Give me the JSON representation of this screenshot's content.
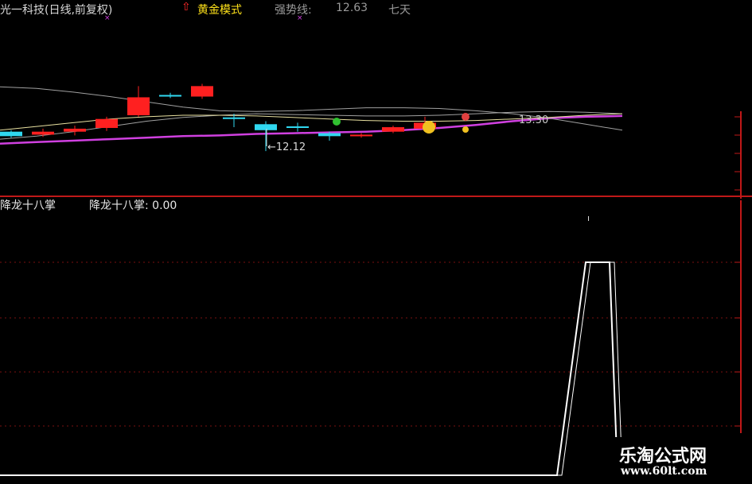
{
  "header": {
    "stock_label": "光一科技(日线,前复权)",
    "mode_arrow": "⇧",
    "mode_label": "黄金模式",
    "strong_line_label": "强势线:",
    "strong_line_value": "12.63",
    "truncated_label": "七天"
  },
  "colors": {
    "background": "#000000",
    "up_candle": "#ff2020",
    "down_candle": "#30d8f0",
    "purple_line": "#d040e0",
    "red_axis": "#c01818",
    "white_line": "#ffffff"
  },
  "annotations": {
    "low_price": "←12.12",
    "high_price": "13.30"
  },
  "indicator": {
    "title": "降龙十八掌",
    "value_label": "降龙十八掌: 0.00"
  },
  "watermark": {
    "name": "乐淘公式网",
    "url": "www.60lt.com"
  },
  "chart_data": [
    {
      "type": "candlestick",
      "title": "光一科技(日线,前复权)",
      "candles": [
        {
          "open": 12.38,
          "close": 12.32,
          "high": 12.4,
          "low": 12.3
        },
        {
          "open": 12.34,
          "close": 12.38,
          "high": 12.42,
          "low": 12.31
        },
        {
          "open": 12.38,
          "close": 12.42,
          "high": 12.46,
          "low": 12.33
        },
        {
          "open": 12.43,
          "close": 12.55,
          "high": 12.58,
          "low": 12.39
        },
        {
          "open": 12.6,
          "close": 12.84,
          "high": 12.99,
          "low": 12.58
        },
        {
          "open": 12.86,
          "close": 12.86,
          "high": 12.9,
          "low": 12.83
        },
        {
          "open": 12.85,
          "close": 12.99,
          "high": 13.02,
          "low": 12.82
        },
        {
          "open": 12.56,
          "close": 12.56,
          "high": 12.62,
          "low": 12.44
        },
        {
          "open": 12.48,
          "close": 12.4,
          "high": 12.52,
          "low": 12.12
        },
        {
          "open": 12.44,
          "close": 12.44,
          "high": 12.5,
          "low": 12.38
        },
        {
          "open": 12.36,
          "close": 12.32,
          "high": 12.38,
          "low": 12.26
        },
        {
          "open": 12.32,
          "close": 12.34,
          "high": 12.36,
          "low": 12.3
        },
        {
          "open": 12.38,
          "close": 12.44,
          "high": 12.46,
          "low": 12.36
        },
        {
          "open": 12.42,
          "close": 12.5,
          "high": 12.58,
          "low": 12.38
        }
      ],
      "lines": [
        {
          "name": "强势线",
          "color": "#d040e0",
          "values": [
            12.22,
            12.24,
            12.26,
            12.28,
            12.3,
            12.32,
            12.33,
            12.35,
            12.36,
            12.37,
            12.38,
            12.4,
            12.43,
            12.47,
            12.52,
            12.56,
            12.58,
            12.59
          ]
        },
        {
          "color": "#a0a0a0",
          "values": [
            12.98,
            12.96,
            12.91,
            12.85,
            12.78,
            12.71,
            12.66,
            12.65,
            12.66,
            12.68,
            12.7,
            12.7,
            12.69,
            12.66,
            12.62,
            12.56,
            12.48,
            12.4
          ]
        },
        {
          "color": "#a0a0a0",
          "values": [
            12.28,
            12.32,
            12.38,
            12.45,
            12.52,
            12.57,
            12.6,
            12.62,
            12.61,
            12.6,
            12.59,
            12.59,
            12.6,
            12.62,
            12.64,
            12.65,
            12.64,
            12.62
          ]
        },
        {
          "color": "#e8e0a0",
          "values": [
            12.4,
            12.45,
            12.5,
            12.55,
            12.58,
            12.6,
            12.6,
            12.59,
            12.57,
            12.55,
            12.53,
            12.52,
            12.52,
            12.53,
            12.55,
            12.57,
            12.6,
            12.62
          ]
        }
      ],
      "labels": [
        "←12.12",
        "13.30"
      ]
    },
    {
      "type": "line",
      "title": "降龙十八掌",
      "x": [
        0,
        1,
        2,
        3,
        4
      ],
      "series": [
        {
          "name": "降龙十八掌",
          "values": [
            0,
            0,
            1,
            1,
            0
          ]
        }
      ]
    }
  ]
}
